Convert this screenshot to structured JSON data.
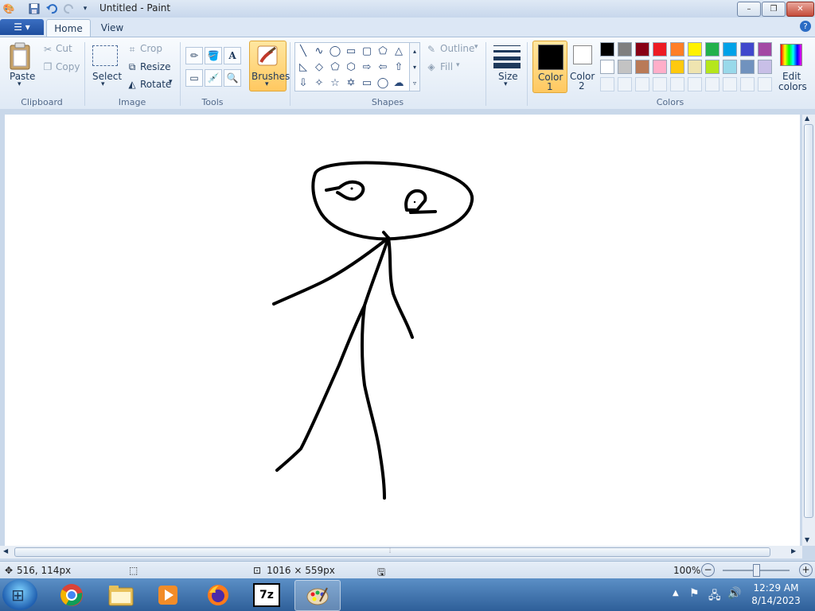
{
  "window": {
    "title": "Untitled - Paint",
    "controls": {
      "minimize": "–",
      "maximize": "❐",
      "close": "✕"
    }
  },
  "tabs": {
    "home": "Home",
    "view": "View",
    "help": "?"
  },
  "ribbon": {
    "clipboard": {
      "label": "Clipboard",
      "paste": "Paste",
      "cut": "Cut",
      "copy": "Copy"
    },
    "image": {
      "label": "Image",
      "select": "Select",
      "crop": "Crop",
      "resize": "Resize",
      "rotate": "Rotate"
    },
    "tools": {
      "label": "Tools"
    },
    "brushes": {
      "label": "Brushes"
    },
    "shapes": {
      "label": "Shapes",
      "outline": "Outline",
      "fill": "Fill"
    },
    "size": {
      "label": "Size"
    },
    "colors": {
      "label": "Colors",
      "color1": "Color",
      "color1_num": "1",
      "color2": "Color",
      "color2_num": "2",
      "edit": "Edit",
      "edit2": "colors",
      "color1_value": "#000000",
      "color2_value": "#ffffff",
      "palette_row1": [
        "#000000",
        "#7f7f7f",
        "#880015",
        "#ed1c24",
        "#ff7f27",
        "#fff200",
        "#22b14c",
        "#00a2e8",
        "#3f48cc",
        "#a349a4"
      ],
      "palette_row2": [
        "#ffffff",
        "#c3c3c3",
        "#b97a57",
        "#ffaec9",
        "#ffc90e",
        "#efe4b0",
        "#b5e61d",
        "#99d9ea",
        "#7092be",
        "#c8bfe7"
      ]
    }
  },
  "status": {
    "cursor": "516, 114px",
    "dimensions": "1016 × 559px",
    "zoom": "100%"
  },
  "taskbar": {
    "time": "12:29 AM",
    "date": "8/14/2023",
    "sevenzip": "7z"
  }
}
